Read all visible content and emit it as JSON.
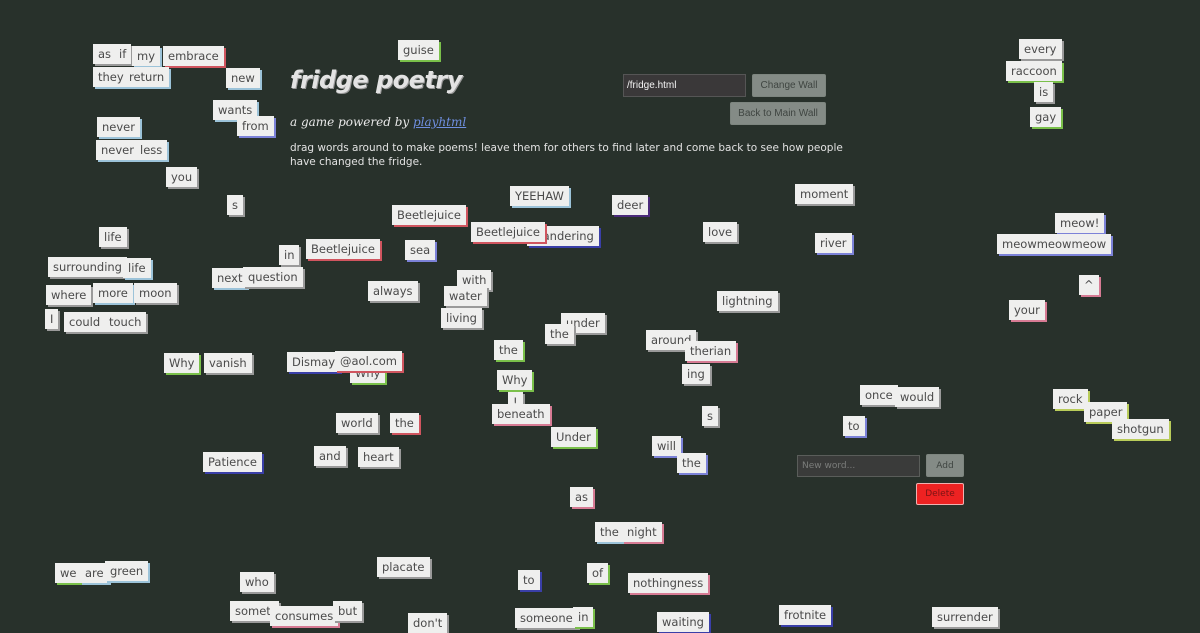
{
  "header": {
    "title": "fridge poetry",
    "subtitle_prefix": "a game powered by ",
    "subtitle_link": "playhtml",
    "description": "drag words around to make poems! leave them for others to find later and come back to see how people have changed the fridge."
  },
  "wall_controls": {
    "wall_input_value": "/fridge.html",
    "change_wall_label": "Change Wall",
    "back_to_main_label": "Back to Main Wall"
  },
  "word_controls": {
    "new_word_placeholder": "New word...",
    "add_label": "Add",
    "delete_label": "Delete"
  },
  "colors": {
    "background": "#28312b",
    "tile": "#efefee",
    "shadow_red": "#d0555f",
    "shadow_green": "#7ac04a",
    "shadow_blue": "#3a3fa8",
    "shadow_lightblue": "#9cc3d9",
    "shadow_periwinkle": "#7c82d8",
    "shadow_pink": "#d77b94",
    "shadow_lime": "#b9cc5a",
    "shadow_purple": "#4a2a7a",
    "shadow_gray": "#9a9a9a",
    "delete": "#ee2222"
  },
  "words": [
    {
      "text": "as",
      "shadow": "gray"
    },
    {
      "text": "if",
      "shadow": "gray"
    },
    {
      "text": "my",
      "shadow": "lightblue"
    },
    {
      "text": "embrace",
      "shadow": "red"
    },
    {
      "text": "they",
      "shadow": "lightblue"
    },
    {
      "text": "return",
      "shadow": "lightblue"
    },
    {
      "text": "new",
      "shadow": "lightblue"
    },
    {
      "text": "guise",
      "shadow": "green"
    },
    {
      "text": "wants",
      "shadow": "lightblue"
    },
    {
      "text": "from",
      "shadow": "periwinkle"
    },
    {
      "text": "never",
      "shadow": "lightblue"
    },
    {
      "text": "never",
      "shadow": "lightblue"
    },
    {
      "text": "less",
      "shadow": "lightblue"
    },
    {
      "text": "you",
      "shadow": "gray"
    },
    {
      "text": "s",
      "shadow": "gray"
    },
    {
      "text": "life",
      "shadow": "gray"
    },
    {
      "text": "surrounding",
      "shadow": "gray"
    },
    {
      "text": "life",
      "shadow": "lightblue"
    },
    {
      "text": "where",
      "shadow": "gray"
    },
    {
      "text": "more",
      "shadow": "lightblue"
    },
    {
      "text": "moon",
      "shadow": "gray"
    },
    {
      "text": "I",
      "shadow": "gray"
    },
    {
      "text": "could",
      "shadow": "gray"
    },
    {
      "text": "touch",
      "shadow": "gray"
    },
    {
      "text": "in",
      "shadow": "gray"
    },
    {
      "text": "next",
      "shadow": "lightblue"
    },
    {
      "text": "question",
      "shadow": "gray"
    },
    {
      "text": "Beetlejuice",
      "shadow": "red"
    },
    {
      "text": "Beetlejuice",
      "shadow": "red"
    },
    {
      "text": "sea",
      "shadow": "periwinkle"
    },
    {
      "text": "always",
      "shadow": "gray"
    },
    {
      "text": "with",
      "shadow": "gray"
    },
    {
      "text": "water",
      "shadow": "gray"
    },
    {
      "text": "living",
      "shadow": "gray"
    },
    {
      "text": "YEEHAW",
      "shadow": "lightblue"
    },
    {
      "text": "Wandering",
      "shadow": "blue"
    },
    {
      "text": "Beetlejuice",
      "shadow": "red"
    },
    {
      "text": "deer",
      "shadow": "purple"
    },
    {
      "text": "love",
      "shadow": "gray"
    },
    {
      "text": "moment",
      "shadow": "gray"
    },
    {
      "text": "river",
      "shadow": "periwinkle"
    },
    {
      "text": "lightning",
      "shadow": "gray"
    },
    {
      "text": "under",
      "shadow": "gray"
    },
    {
      "text": "the",
      "shadow": "gray"
    },
    {
      "text": "around",
      "shadow": "gray"
    },
    {
      "text": "therian",
      "shadow": "pink"
    },
    {
      "text": "ing",
      "shadow": "gray"
    },
    {
      "text": "the",
      "shadow": "green"
    },
    {
      "text": "Why",
      "shadow": "green"
    },
    {
      "text": "!",
      "shadow": "gray"
    },
    {
      "text": "beneath",
      "shadow": "pink"
    },
    {
      "text": "Under",
      "shadow": "green"
    },
    {
      "text": "s",
      "shadow": "gray"
    },
    {
      "text": "will",
      "shadow": "periwinkle"
    },
    {
      "text": "the",
      "shadow": "periwinkle"
    },
    {
      "text": "every",
      "shadow": "gray"
    },
    {
      "text": "raccoon",
      "shadow": "green"
    },
    {
      "text": "is",
      "shadow": "gray"
    },
    {
      "text": "gay",
      "shadow": "green"
    },
    {
      "text": "meow!",
      "shadow": "periwinkle"
    },
    {
      "text": "meowmeowmeow",
      "shadow": "periwinkle"
    },
    {
      "text": "^",
      "shadow": "pink"
    },
    {
      "text": "your",
      "shadow": "pink"
    },
    {
      "text": "Why",
      "shadow": "green"
    },
    {
      "text": "vanish",
      "shadow": "gray"
    },
    {
      "text": "Why",
      "shadow": "green"
    },
    {
      "text": "Dismay",
      "shadow": "blue"
    },
    {
      "text": "@aol.com",
      "shadow": "red"
    },
    {
      "text": "world",
      "shadow": "gray"
    },
    {
      "text": "the",
      "shadow": "red"
    },
    {
      "text": "Patience",
      "shadow": "blue"
    },
    {
      "text": "and",
      "shadow": "gray"
    },
    {
      "text": "heart",
      "shadow": "gray"
    },
    {
      "text": "once",
      "shadow": "gray"
    },
    {
      "text": "would",
      "shadow": "gray"
    },
    {
      "text": "to",
      "shadow": "periwinkle"
    },
    {
      "text": "rock",
      "shadow": "lime"
    },
    {
      "text": "paper",
      "shadow": "lime"
    },
    {
      "text": "shotgun",
      "shadow": "lime"
    },
    {
      "text": "as",
      "shadow": "pink"
    },
    {
      "text": "the",
      "shadow": "lightblue"
    },
    {
      "text": "night",
      "shadow": "pink"
    },
    {
      "text": "we",
      "shadow": "green"
    },
    {
      "text": "are",
      "shadow": "lightblue"
    },
    {
      "text": "green",
      "shadow": "lightblue"
    },
    {
      "text": "who",
      "shadow": "gray"
    },
    {
      "text": "placate",
      "shadow": "gray"
    },
    {
      "text": "someti",
      "shadow": "gray"
    },
    {
      "text": "consumes",
      "shadow": "pink"
    },
    {
      "text": "but",
      "shadow": "gray"
    },
    {
      "text": "don't",
      "shadow": "gray"
    },
    {
      "text": "to",
      "shadow": "blue"
    },
    {
      "text": "of",
      "shadow": "green"
    },
    {
      "text": "nothingness",
      "shadow": "pink"
    },
    {
      "text": "someone",
      "shadow": "gray"
    },
    {
      "text": "in",
      "shadow": "green"
    },
    {
      "text": "waiting",
      "shadow": "blue"
    },
    {
      "text": "frotnite",
      "shadow": "blue"
    },
    {
      "text": "surrender",
      "shadow": "gray"
    }
  ]
}
